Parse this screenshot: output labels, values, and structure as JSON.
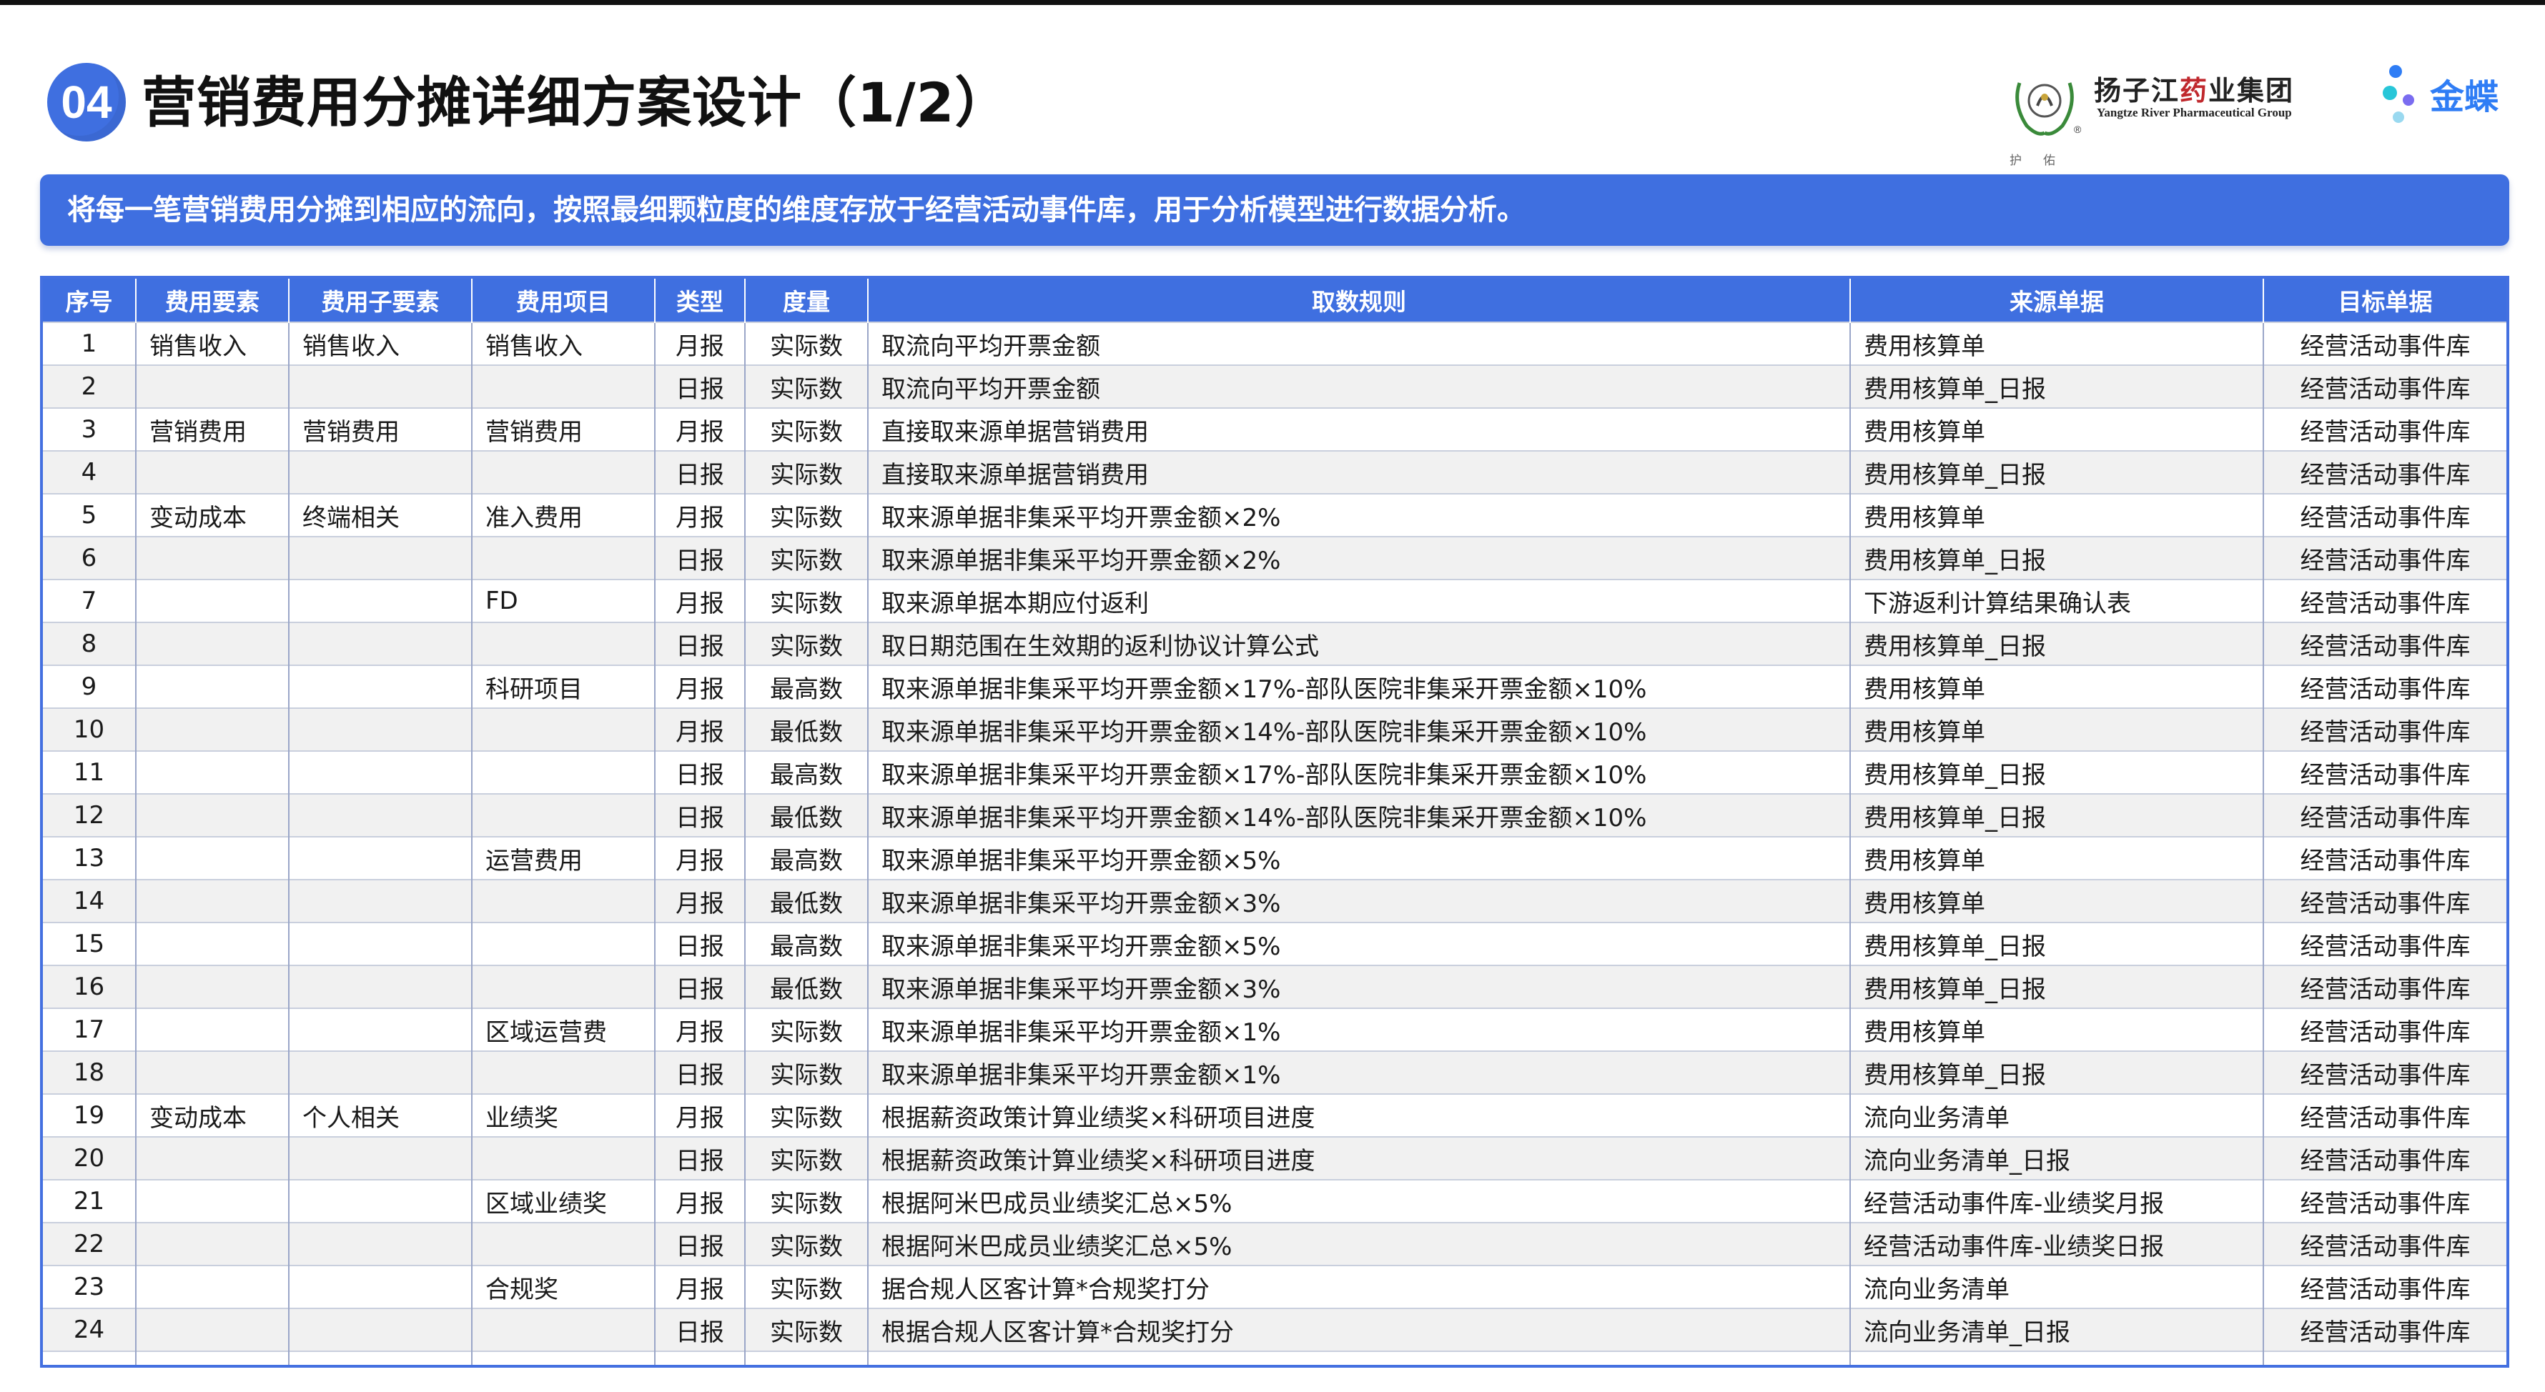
{
  "header": {
    "badge": "04",
    "title": "营销费用分摊详细方案设计（1/2）"
  },
  "logos": {
    "yangtze": {
      "name": "扬子江药业集团",
      "english": "Yangtze River Pharmaceutical Group",
      "sub": "护佑"
    },
    "kingdee": {
      "name": "金蝶"
    }
  },
  "banner": {
    "text": "将每一笔营销费用分摊到相应的流向，按照最细颗粒度的维度存放于经营活动事件库，用于分析模型进行数据分析。"
  },
  "table": {
    "columns": [
      "序号",
      "费用要素",
      "费用子要素",
      "费用项目",
      "类型",
      "度量",
      "取数规则",
      "来源单据",
      "目标单据"
    ],
    "rows": [
      [
        "1",
        "销售收入",
        "销售收入",
        "销售收入",
        "月报",
        "实际数",
        "取流向平均开票金额",
        "费用核算单",
        "经营活动事件库"
      ],
      [
        "2",
        "",
        "",
        "",
        "日报",
        "实际数",
        "取流向平均开票金额",
        "费用核算单_日报",
        "经营活动事件库"
      ],
      [
        "3",
        "营销费用",
        "营销费用",
        "营销费用",
        "月报",
        "实际数",
        "直接取来源单据营销费用",
        "费用核算单",
        "经营活动事件库"
      ],
      [
        "4",
        "",
        "",
        "",
        "日报",
        "实际数",
        "直接取来源单据营销费用",
        "费用核算单_日报",
        "经营活动事件库"
      ],
      [
        "5",
        "变动成本",
        "终端相关",
        "准入费用",
        "月报",
        "实际数",
        "取来源单据非集采平均开票金额×2%",
        "费用核算单",
        "经营活动事件库"
      ],
      [
        "6",
        "",
        "",
        "",
        "日报",
        "实际数",
        "取来源单据非集采平均开票金额×2%",
        "费用核算单_日报",
        "经营活动事件库"
      ],
      [
        "7",
        "",
        "",
        "FD",
        "月报",
        "实际数",
        "取来源单据本期应付返利",
        "下游返利计算结果确认表",
        "经营活动事件库"
      ],
      [
        "8",
        "",
        "",
        "",
        "日报",
        "实际数",
        "取日期范围在生效期的返利协议计算公式",
        "费用核算单_日报",
        "经营活动事件库"
      ],
      [
        "9",
        "",
        "",
        "科研项目",
        "月报",
        "最高数",
        "取来源单据非集采平均开票金额×17%-部队医院非集采开票金额×10%",
        "费用核算单",
        "经营活动事件库"
      ],
      [
        "10",
        "",
        "",
        "",
        "月报",
        "最低数",
        "取来源单据非集采平均开票金额×14%-部队医院非集采开票金额×10%",
        "费用核算单",
        "经营活动事件库"
      ],
      [
        "11",
        "",
        "",
        "",
        "日报",
        "最高数",
        "取来源单据非集采平均开票金额×17%-部队医院非集采开票金额×10%",
        "费用核算单_日报",
        "经营活动事件库"
      ],
      [
        "12",
        "",
        "",
        "",
        "日报",
        "最低数",
        "取来源单据非集采平均开票金额×14%-部队医院非集采开票金额×10%",
        "费用核算单_日报",
        "经营活动事件库"
      ],
      [
        "13",
        "",
        "",
        "运营费用",
        "月报",
        "最高数",
        "取来源单据非集采平均开票金额×5%",
        "费用核算单",
        "经营活动事件库"
      ],
      [
        "14",
        "",
        "",
        "",
        "月报",
        "最低数",
        "取来源单据非集采平均开票金额×3%",
        "费用核算单",
        "经营活动事件库"
      ],
      [
        "15",
        "",
        "",
        "",
        "日报",
        "最高数",
        "取来源单据非集采平均开票金额×5%",
        "费用核算单_日报",
        "经营活动事件库"
      ],
      [
        "16",
        "",
        "",
        "",
        "日报",
        "最低数",
        "取来源单据非集采平均开票金额×3%",
        "费用核算单_日报",
        "经营活动事件库"
      ],
      [
        "17",
        "",
        "",
        "区域运营费",
        "月报",
        "实际数",
        "取来源单据非集采平均开票金额×1%",
        "费用核算单",
        "经营活动事件库"
      ],
      [
        "18",
        "",
        "",
        "",
        "日报",
        "实际数",
        "取来源单据非集采平均开票金额×1%",
        "费用核算单_日报",
        "经营活动事件库"
      ],
      [
        "19",
        "变动成本",
        "个人相关",
        "业绩奖",
        "月报",
        "实际数",
        "根据薪资政策计算业绩奖×科研项目进度",
        "流向业务清单",
        "经营活动事件库"
      ],
      [
        "20",
        "",
        "",
        "",
        "日报",
        "实际数",
        "根据薪资政策计算业绩奖×科研项目进度",
        "流向业务清单_日报",
        "经营活动事件库"
      ],
      [
        "21",
        "",
        "",
        "区域业绩奖",
        "月报",
        "实际数",
        "根据阿米巴成员业绩奖汇总×5%",
        "经营活动事件库-业绩奖月报",
        "经营活动事件库"
      ],
      [
        "22",
        "",
        "",
        "",
        "日报",
        "实际数",
        "根据阿米巴成员业绩奖汇总×5%",
        "经营活动事件库-业绩奖日报",
        "经营活动事件库"
      ],
      [
        "23",
        "",
        "",
        "合规奖",
        "月报",
        "实际数",
        "据合规人区客计算*合规奖打分",
        "流向业务清单",
        "经营活动事件库"
      ],
      [
        "24",
        "",
        "",
        "",
        "日报",
        "实际数",
        "根据合规人区客计算*合规奖打分",
        "流向业务清单_日报",
        "经营活动事件库"
      ],
      [
        "",
        "",
        "",
        "",
        "",
        "",
        "",
        "",
        ""
      ]
    ]
  }
}
